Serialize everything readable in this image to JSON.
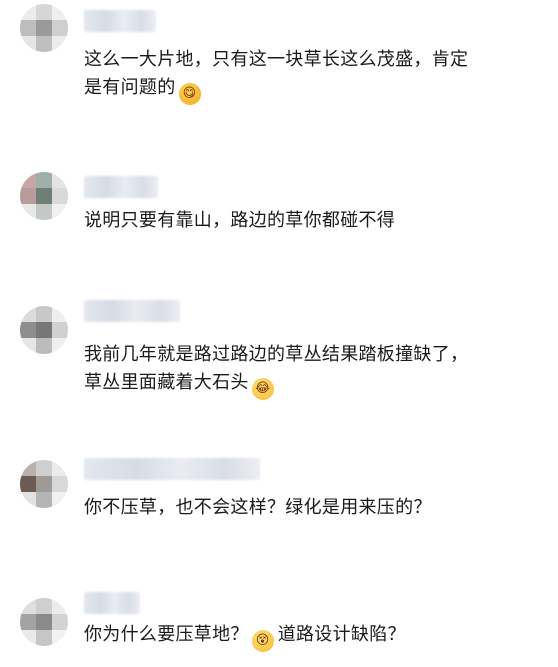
{
  "comments": [
    {
      "lines": [
        "这么一大片地，只有这一块草长这么茂盛，肯定",
        "是有问题的"
      ],
      "emoji": "yummy-face-emoji",
      "avatar_colors": [
        "#ececec",
        "#d6d6d6",
        "#efefef",
        "#bdbdbd",
        "#9a9a9a",
        "#cfcfcf",
        "#e5e5e5",
        "#bfbfbf",
        "#ececec"
      ]
    },
    {
      "lines": [
        "说明只要有靠山，路边的草你都碰不得"
      ],
      "avatar_colors": [
        "#c9a6a6",
        "#9fb0a8",
        "#e4e4e4",
        "#b89b9b",
        "#6f7f76",
        "#d9d9d9",
        "#e8e8e8",
        "#c5c9c6",
        "#f0f0f0"
      ]
    },
    {
      "lines": [
        "我前几年就是路过路边的草丛结果踏板撞缺了，",
        "草丛里面藏着大石头"
      ],
      "emoji": "crying-laugh-emoji",
      "avatar_colors": [
        "#dcdcdc",
        "#c8c8c8",
        "#eeeeee",
        "#8e8e8e",
        "#777777",
        "#d0d0d0",
        "#e6e6e6",
        "#bcbcbc",
        "#efefef"
      ]
    },
    {
      "lines": [
        "你不压草，也不会这样？绿化是用来压的？"
      ],
      "avatar_colors": [
        "#b8b2ae",
        "#cfcfcf",
        "#ececec",
        "#6d5a52",
        "#a09a96",
        "#d8d8d8",
        "#e2e2e2",
        "#b5b5b5",
        "#f0f0f0"
      ]
    },
    {
      "text_before": "你为什么要压草地？",
      "emoji": "dizzy-face-emoji",
      "text_after": "道路设计缺陷？",
      "avatar_colors": [
        "#dedede",
        "#cfcfcf",
        "#ededed",
        "#a3a3a3",
        "#8a8a8a",
        "#d3d3d3",
        "#e9e9e9",
        "#c6c6c6",
        "#f2f2f2"
      ]
    }
  ]
}
